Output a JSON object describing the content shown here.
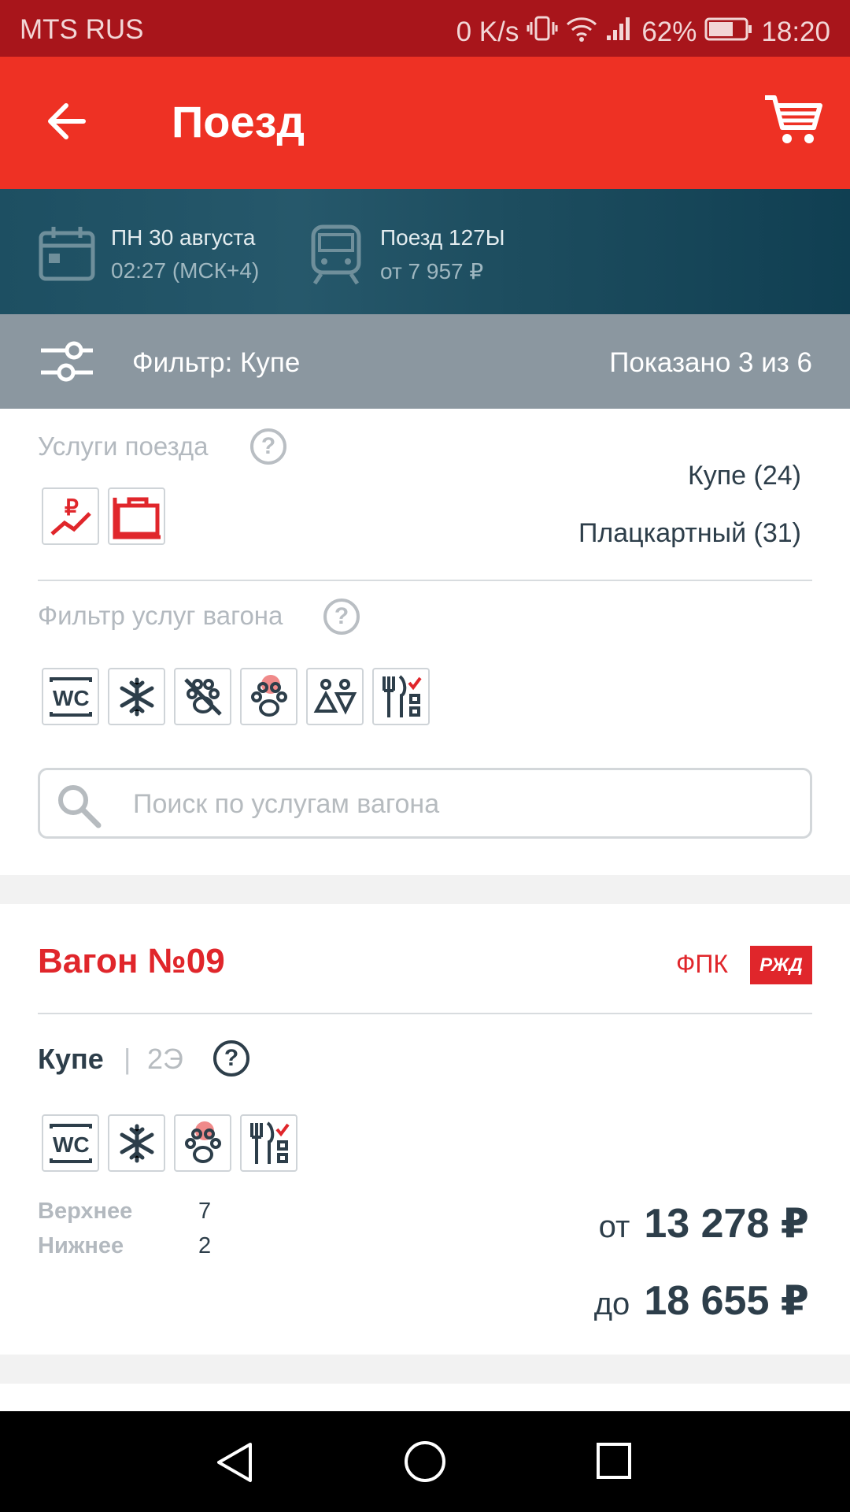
{
  "status_bar": {
    "carrier": "MTS RUS",
    "speed": "0 K/s",
    "battery": "62%",
    "time": "18:20"
  },
  "app_bar": {
    "title": "Поезд",
    "back_icon": "arrow-left-icon",
    "cart_icon": "cart-icon"
  },
  "trip": {
    "date": "ПН 30 августа",
    "time": "02:27 (МСК+4)",
    "train": "Поезд 127Ы",
    "price_from": "от 7 957 ₽"
  },
  "filter": {
    "label": "Фильтр: Купе",
    "shown": "Показано 3 из 6"
  },
  "train_services": {
    "title": "Услуги поезда",
    "icons": [
      "dynamic-price-icon",
      "luggage-icon"
    ],
    "classes": [
      "Купе (24)",
      "Плацкартный (31)"
    ]
  },
  "car_services_filter": {
    "title": "Фильтр услуг вагона",
    "icons": [
      "wc-icon",
      "snowflake-icon",
      "no-pets-icon",
      "pets-icon",
      "family-icon",
      "food-icon"
    ]
  },
  "search": {
    "placeholder": "Поиск по услугам вагона"
  },
  "car": {
    "title": "Вагон №09",
    "carrier": "ФПК",
    "logo_text": "РЖД",
    "class": "Купе",
    "separator": "|",
    "subclass": "2Э",
    "icons": [
      "wc-icon",
      "snowflake-icon",
      "pets-icon",
      "food-icon"
    ],
    "seats": [
      {
        "label": "Верхнее",
        "count": "7"
      },
      {
        "label": "Нижнее",
        "count": "2"
      }
    ],
    "price_from_prefix": "от",
    "price_from": "13 278 ₽",
    "price_to_prefix": "до",
    "price_to": "18 655 ₽"
  },
  "colors": {
    "status_bar": "#a8151b",
    "app_bar": "#ee3124",
    "filter_bar": "#8b97a0",
    "accent_red": "#e0262b",
    "dark_text": "#2d3e4a"
  }
}
